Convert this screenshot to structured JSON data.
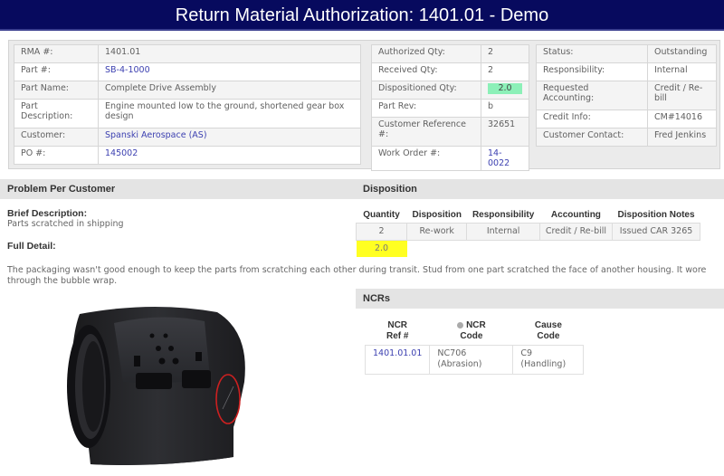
{
  "header": {
    "title": "Return Material Authorization: 1401.01 - Demo",
    "background_color": "#070a5e"
  },
  "info": {
    "left": [
      {
        "label": "RMA #:",
        "value": "1401.01",
        "link": false
      },
      {
        "label": "Part #:",
        "value": "SB-4-1000",
        "link": true
      },
      {
        "label": "Part Name:",
        "value": "Complete Drive Assembly",
        "link": false
      },
      {
        "label": "Part Description:",
        "value": "Engine mounted low to the ground, shortened gear box design",
        "link": false
      },
      {
        "label": "Customer:",
        "value": "Spanski Aerospace (AS)",
        "link": true
      },
      {
        "label": "PO #:",
        "value": "145002",
        "link": true
      }
    ],
    "middle": [
      {
        "label": "Authorized Qty:",
        "value": "2",
        "link": false
      },
      {
        "label": "Received Qty:",
        "value": "2",
        "link": false
      },
      {
        "label": "Dispositioned Qty:",
        "value": "2.0",
        "link": false,
        "highlight": "#8cf0b8"
      },
      {
        "label": "Part Rev:",
        "value": "b",
        "link": false
      },
      {
        "label": "Customer Reference #:",
        "value": "32651",
        "link": false
      },
      {
        "label": "Work Order #:",
        "value": "14-0022",
        "link": true
      }
    ],
    "right": [
      {
        "label": "Status:",
        "value": "Outstanding"
      },
      {
        "label": "Responsibility:",
        "value": "Internal"
      },
      {
        "label": "Requested Accounting:",
        "value": "Credit / Re-bill"
      },
      {
        "label": "Credit Info:",
        "value": "CM#14016"
      },
      {
        "label": "Customer Contact:",
        "value": "Fred Jenkins"
      }
    ]
  },
  "problem": {
    "section_title": "Problem Per Customer",
    "brief_label": "Brief Description:",
    "brief_value": "Parts scratched in shipping",
    "full_label": "Full Detail:",
    "full_value": "The packaging wasn't good enough to keep the parts from scratching each other during transit. Stud from one part scratched the face of another housing. It wore through the bubble wrap.",
    "photo_description": "black drive housing with scratch circled in red"
  },
  "disposition": {
    "section_title": "Disposition",
    "columns": [
      "Quantity",
      "Disposition",
      "Responsibility",
      "Accounting",
      "Disposition Notes"
    ],
    "rows": [
      [
        "2",
        "Re-work",
        "Internal",
        "Credit / Re-bill",
        "Issued CAR 3265"
      ]
    ],
    "total": "2.0",
    "total_highlight": "#ffff22"
  },
  "ncrs": {
    "section_title": "NCRs",
    "columns": [
      {
        "line1": "NCR",
        "line2": "Ref #",
        "info_icon": false
      },
      {
        "line1": "NCR",
        "line2": "Code",
        "info_icon": true
      },
      {
        "line1": "Cause",
        "line2": "Code",
        "info_icon": false
      }
    ],
    "rows": [
      {
        "ref": "1401.01.01",
        "code_line1": "NC706",
        "code_line2": "(Abrasion)",
        "cause_line1": "C9",
        "cause_line2": "(Handling)"
      }
    ]
  },
  "colors": {
    "link": "#3b3fb0",
    "section_header_bg": "#e4e4e4",
    "scratch_marker": "#cc2020"
  }
}
